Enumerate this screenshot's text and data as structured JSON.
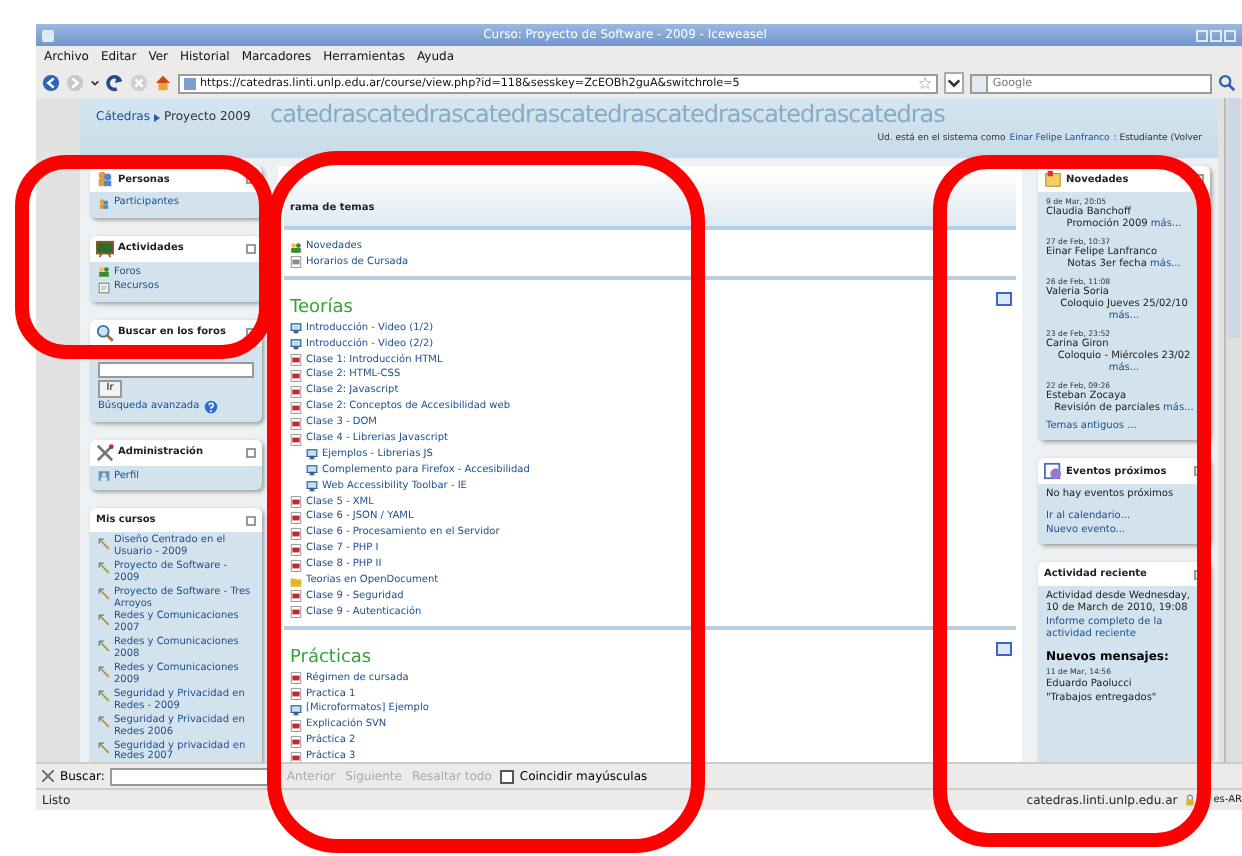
{
  "window": {
    "title": "Curso: Proyecto de Software - 2009 - Iceweasel"
  },
  "menu": [
    "Archivo",
    "Editar",
    "Ver",
    "Historial",
    "Marcadores",
    "Herramientas",
    "Ayuda"
  ],
  "address": {
    "value": "https://catedras.linti.unlp.edu.ar/course/view.php?id=118&sesskey=ZcEOBh2guA&switchrole=5"
  },
  "search": {
    "placeholder": "Google"
  },
  "page_header": {
    "banner": "catedrascatedrascatedrascatedrascatedrascatedrascatedras",
    "breadcrumb": [
      "Cátedras",
      "Proyecto 2009"
    ],
    "login_info": "Ud. está en el sistema como",
    "user": "Einar Felipe Lanfranco",
    "login_rest": ": Estudiante (Volver"
  },
  "left_blocks": [
    {
      "kind": "links",
      "title": "Personas",
      "items": [
        {
          "label": "Participantes"
        }
      ]
    },
    {
      "kind": "links",
      "title": "Actividades",
      "items": [
        {
          "label": "Foros"
        },
        {
          "label": "Recursos"
        }
      ]
    },
    {
      "kind": "search",
      "title": "Buscar en los foros",
      "button": "Ir",
      "link": "Búsqueda avanzada"
    },
    {
      "kind": "links",
      "title": "Administración",
      "items": [
        {
          "label": "Perfil"
        }
      ]
    },
    {
      "kind": "courses",
      "title": "Mis cursos",
      "items": [
        {
          "label": "Diseño Centrado en el Usuario - 2009"
        },
        {
          "label": "Proyecto de Software - 2009"
        },
        {
          "label": "Proyecto de Software - Tres Arroyos"
        },
        {
          "label": "Redes y Comunicaciones 2007"
        },
        {
          "label": "Redes y Comunicaciones 2008"
        },
        {
          "label": "Redes y Comunicaciones 2009"
        },
        {
          "label": "Seguridad y Privacidad en Redes - 2009"
        },
        {
          "label": "Seguridad y Privacidad en Redes 2006"
        },
        {
          "label": "Seguridad y privacidad en Redes 2007"
        }
      ]
    }
  ],
  "topics": {
    "header": "rama de temas",
    "sections": [
      {
        "items": [
          {
            "label": "Novedades",
            "kind": "forum"
          },
          {
            "label": "Horarios de Cursada",
            "kind": "doc"
          }
        ]
      },
      {
        "title": "Teorías",
        "items": [
          {
            "label": "Introducción - Video (1/2)",
            "kind": "web"
          },
          {
            "label": "Introducción - Video (2/2)",
            "kind": "web"
          },
          {
            "label": "Clase 1: Introducción HTML",
            "kind": "pdf"
          },
          {
            "label": "Clase 2: HTML-CSS",
            "kind": "pdf"
          },
          {
            "label": "Clase 2: Javascript",
            "kind": "pdf"
          },
          {
            "label": "Clase 2: Conceptos de Accesibilidad web",
            "kind": "pdf"
          },
          {
            "label": "Clase 3 - DOM",
            "kind": "pdf"
          },
          {
            "label": "Clase 4 - Librerias Javascript",
            "kind": "pdf",
            "children": [
              {
                "label": "Ejemplos - Librerias JS",
                "kind": "web"
              },
              {
                "label": "Complemento para Firefox - Accesibilidad",
                "kind": "web"
              },
              {
                "label": "Web Accessibility Toolbar - IE",
                "kind": "web"
              }
            ]
          },
          {
            "label": "Clase 5 - XML",
            "kind": "pdf"
          },
          {
            "label": "Clase 6 - JSON / YAML",
            "kind": "pdf"
          },
          {
            "label": "Clase 6 - Procesamiento en el Servidor",
            "kind": "pdf"
          },
          {
            "label": "Clase 7 - PHP I",
            "kind": "pdf"
          },
          {
            "label": "Clase 8 - PHP II",
            "kind": "pdf"
          },
          {
            "label": "Teorias en OpenDocument",
            "kind": "folder"
          },
          {
            "label": "Clase 9 - Seguridad",
            "kind": "pdf"
          },
          {
            "label": "Clase 9 - Autenticación",
            "kind": "pdf"
          }
        ]
      },
      {
        "title": "Prácticas",
        "items": [
          {
            "label": "Régimen de cursada",
            "kind": "pdf"
          },
          {
            "label": "Practica 1",
            "kind": "pdf"
          },
          {
            "label": "[Microformatos] Ejemplo",
            "kind": "web"
          },
          {
            "label": "Explicación SVN",
            "kind": "pdf"
          },
          {
            "label": "Práctica 2",
            "kind": "pdf"
          },
          {
            "label": "Práctica 3",
            "kind": "pdf"
          }
        ]
      }
    ]
  },
  "news": {
    "title": "Novedades",
    "posts": [
      {
        "date": "9 de Mar, 20:05",
        "author": "Claudia Banchoff",
        "subject": "Promoción 2009",
        "more": "más..."
      },
      {
        "date": "27 de Feb, 10:37",
        "author": "Einar Felipe Lanfranco",
        "subject": "Notas 3er fecha",
        "more": "más..."
      },
      {
        "date": "26 de Feb, 11:08",
        "author": "Valeria Soria",
        "subject": "Coloquio Jueves 25/02/10",
        "more": "más..."
      },
      {
        "date": "23 de Feb, 23:52",
        "author": "Carina Giron",
        "subject": "Coloquio - Miércoles 23/02",
        "more": "más..."
      },
      {
        "date": "22 de Feb, 09:26",
        "author": "Esteban Zocaya",
        "subject": "Revisión de parciales",
        "more": "más..."
      }
    ],
    "older": "Temas antiguos ..."
  },
  "events": {
    "title": "Eventos próximos",
    "empty": "No hay eventos próximos",
    "links": [
      "Ir al calendario...",
      "Nuevo evento..."
    ]
  },
  "recent": {
    "title": "Actividad reciente",
    "since": "Actividad desde Wednesday, 10 de March de 2010, 19:08",
    "report": "Informe completo de la actividad reciente",
    "new_heading": "Nuevos mensajes:",
    "post": {
      "date": "11 de Mar, 14:56",
      "author": "Eduardo Paolucci",
      "subject": "\"Trabajos entregados\""
    }
  },
  "find_bar": {
    "label": "Buscar:",
    "buttons": [
      {
        "label": "Anterior",
        "disabled": true
      },
      {
        "label": "Siguiente",
        "disabled": true
      },
      {
        "label": "Resaltar todo",
        "disabled": true
      }
    ],
    "match_case": {
      "label": "Coincidir mayúsculas",
      "checked": false
    }
  },
  "status_bar": {
    "text": "Listo",
    "host": "catedras.linti.unlp.edu.ar",
    "locale": "es-AR"
  }
}
